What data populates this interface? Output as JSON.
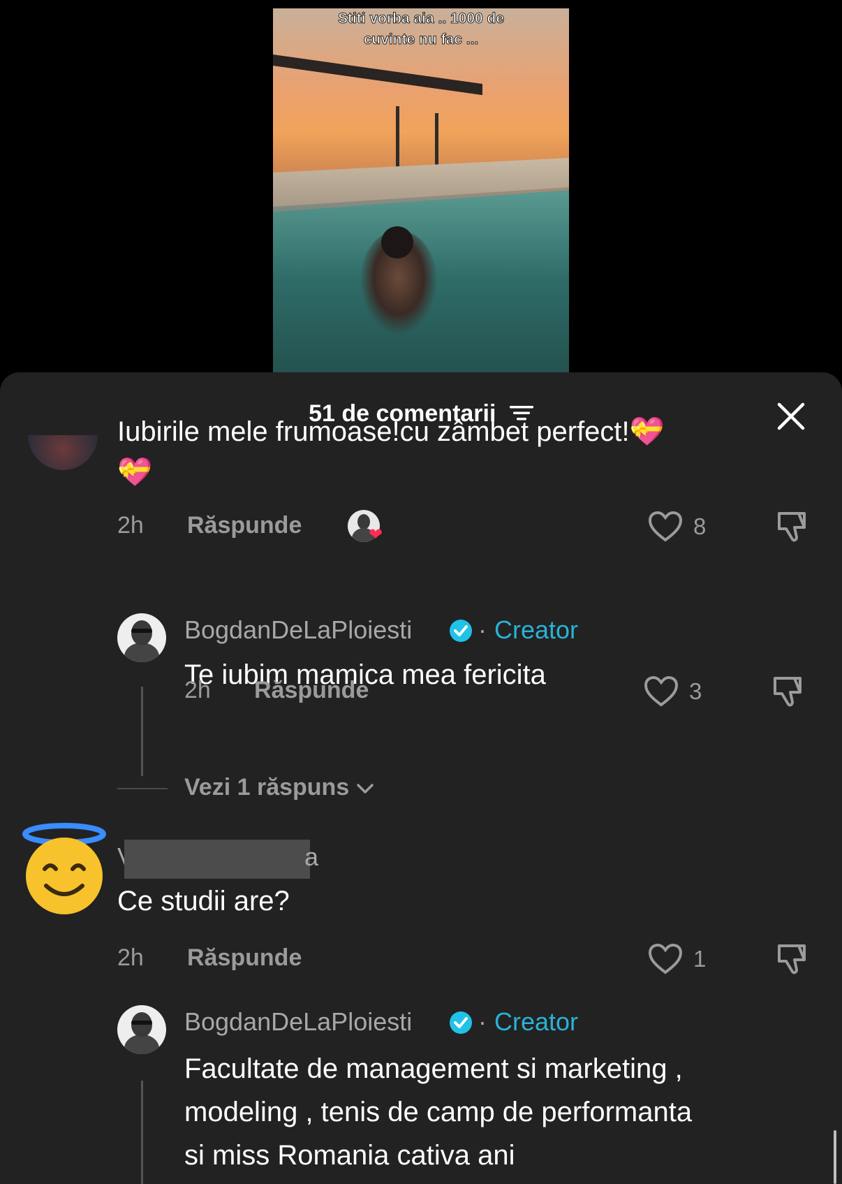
{
  "video": {
    "caption_line1": "Stiti vorba aia .. 1000 de",
    "caption_line2": "cuvinte nu fac ..."
  },
  "header": {
    "title": "51 de comentarii"
  },
  "comments": [
    {
      "text_line1": "Iubirile mele frumoase!cu zâmbet perfect!💝",
      "text_line2": "💝",
      "time": "2h",
      "reply_label": "Răspunde",
      "likes": "8",
      "creator_liked": true
    },
    {
      "username": "BogdanDeLaPloiesti",
      "badge": "Creator",
      "separator": "·",
      "text": "Te iubim mamica mea fericita",
      "time": "2h",
      "reply_label": "Răspunde",
      "likes": "3"
    },
    {
      "view_replies": "Vezi 1 răspuns"
    },
    {
      "username_start": "V",
      "username_end": "a",
      "avatar_emoji": "😇",
      "text": "Ce studii are?",
      "time": "2h",
      "reply_label": "Răspunde",
      "likes": "1"
    },
    {
      "username": "BogdanDeLaPloiesti",
      "badge": "Creator",
      "separator": "·",
      "text_line1": "Facultate de management si marketing ,",
      "text_line2": "modeling , tenis de camp de performanta",
      "text_line3": "si miss Romania cativa ani"
    }
  ],
  "colors": {
    "sheet_bg": "#222222",
    "creator_accent": "#2ab2d6",
    "verified_badge": "#20c2e8",
    "like_heart": "#ff2c55"
  }
}
